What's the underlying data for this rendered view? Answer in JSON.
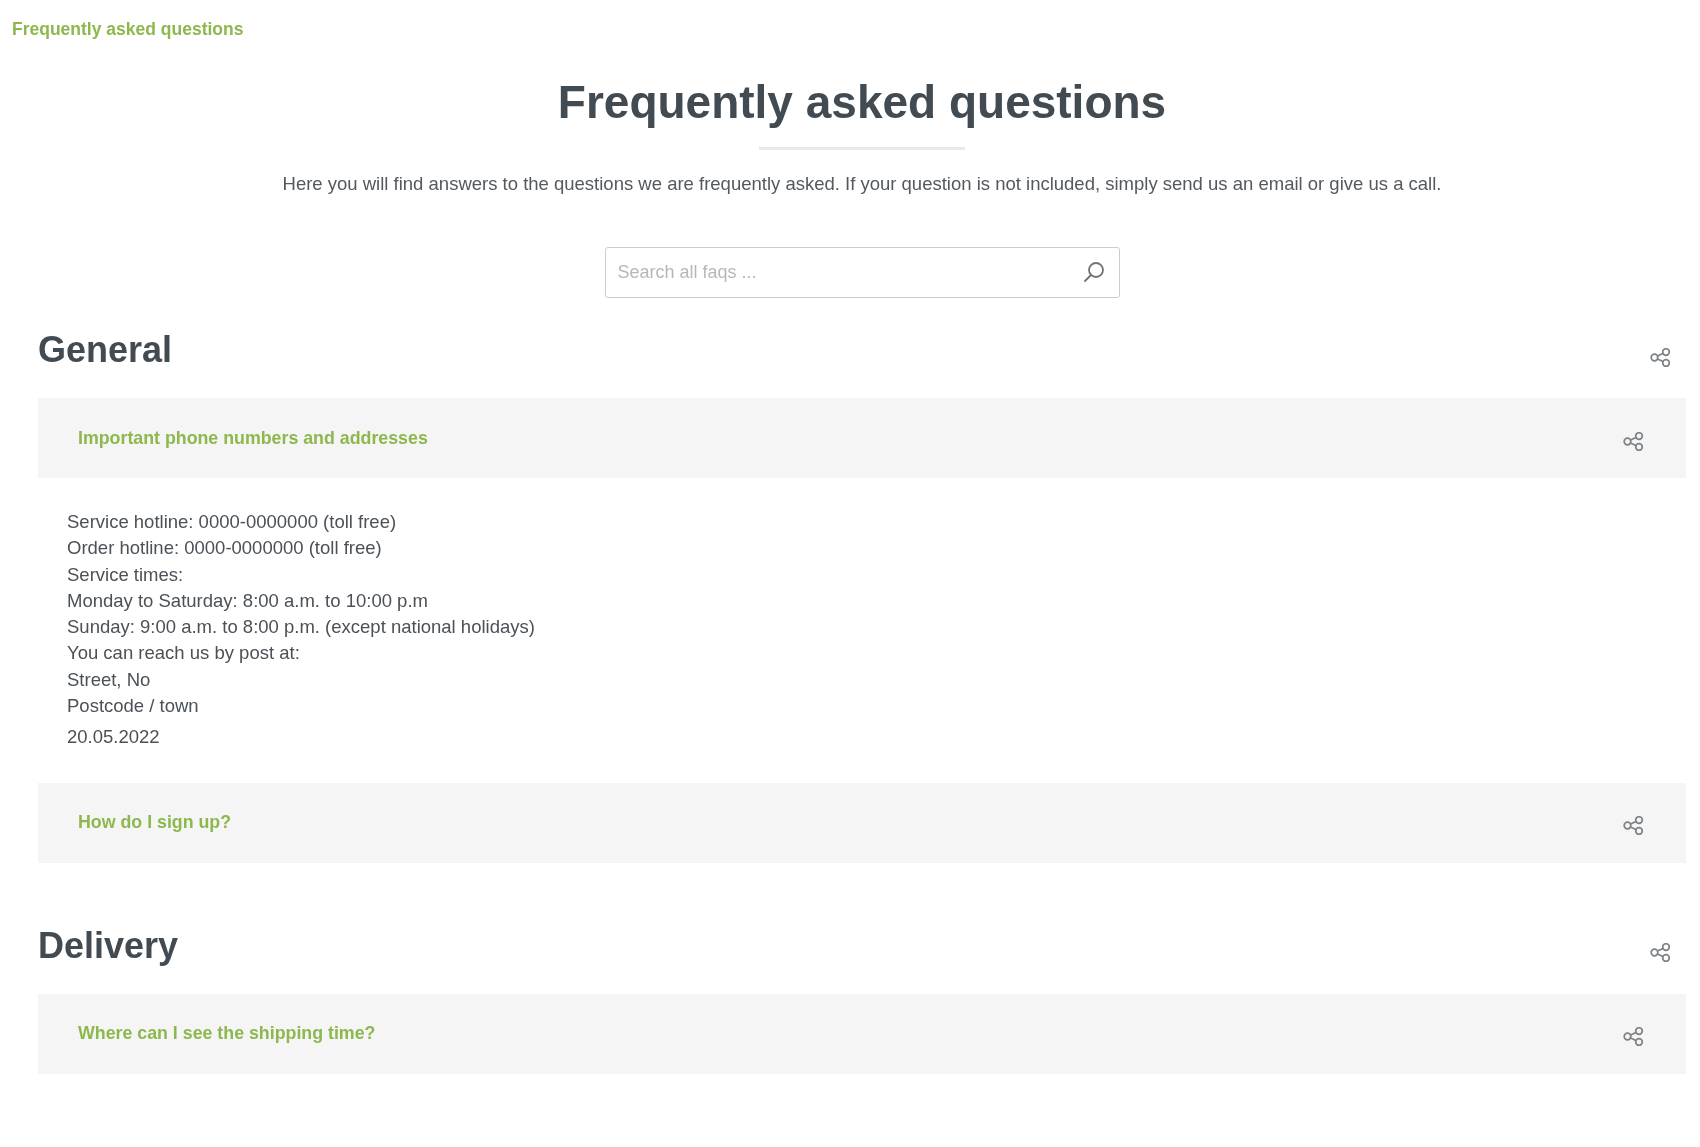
{
  "breadcrumb": {
    "label": "Frequently asked questions"
  },
  "header": {
    "title": "Frequently asked questions",
    "intro": "Here you will find answers to the questions we are frequently asked. If your question is not included, simply send us an email or give us a call."
  },
  "search": {
    "placeholder": "Search all faqs ..."
  },
  "sections": [
    {
      "title": "General",
      "questions": [
        {
          "question": "Important phone numbers and addresses",
          "expanded": true,
          "answer": [
            "Service hotline: 0000-0000000 (toll free)",
            "Order hotline: 0000-0000000 (toll free)",
            "Service times:",
            "Monday to Saturday: 8:00 a.m. to 10:00 p.m",
            "Sunday: 9:00 a.m. to 8:00 p.m. (except national holidays)",
            "You can reach us by post at:",
            "Street, No",
            "Postcode / town"
          ],
          "date": "20.05.2022"
        },
        {
          "question": "How do I sign up?",
          "expanded": false
        }
      ]
    },
    {
      "title": "Delivery",
      "questions": [
        {
          "question": "Where can I see the shipping time?",
          "expanded": false
        }
      ]
    }
  ]
}
